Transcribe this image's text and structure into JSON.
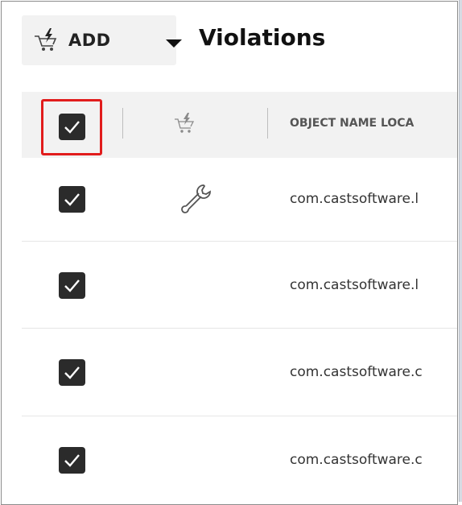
{
  "toolbar": {
    "add_label": "ADD",
    "add_icon": "cart-lightning-icon",
    "dropdown_icon": "caret-down-icon"
  },
  "page_title": "Violations",
  "table": {
    "columns": [
      {
        "name": "select-all",
        "type": "checkbox",
        "checked": true
      },
      {
        "name": "action",
        "icon": "cart-lightning-icon"
      },
      {
        "name": "object-name",
        "label": "OBJECT NAME LOCA"
      }
    ],
    "rows": [
      {
        "checked": true,
        "icon": "wrench-icon",
        "object_name": "com.castsoftware.l"
      },
      {
        "checked": true,
        "icon": "",
        "object_name": "com.castsoftware.l"
      },
      {
        "checked": true,
        "icon": "",
        "object_name": "com.castsoftware.c"
      },
      {
        "checked": true,
        "icon": "",
        "object_name": "com.castsoftware.c"
      }
    ]
  },
  "colors": {
    "highlight": "#e11c1c",
    "header_bg": "#f2f2f2",
    "checkbox": "#2b2b2b"
  }
}
